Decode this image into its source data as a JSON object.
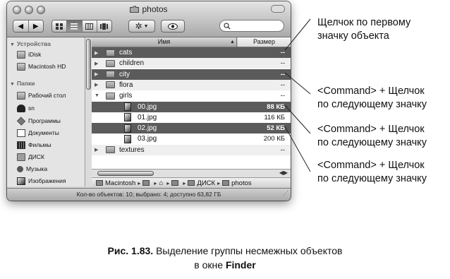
{
  "window": {
    "title": "photos",
    "search_value": ""
  },
  "sidebar": {
    "devices_heading": "Устройства",
    "devices": [
      {
        "label": "iDisk",
        "icon": "idisk-icon"
      },
      {
        "label": "Macintosh HD",
        "icon": "hard-disk-icon"
      }
    ],
    "places_heading": "Папки",
    "places": [
      {
        "label": "Рабочий стол",
        "icon": "desktop-icon"
      },
      {
        "label": "sn",
        "icon": "home-icon"
      },
      {
        "label": "Программы",
        "icon": "applications-icon"
      },
      {
        "label": "Документы",
        "icon": "documents-icon"
      },
      {
        "label": "Фильмы",
        "icon": "movies-icon"
      },
      {
        "label": "ДИСК",
        "icon": "folder-icon"
      },
      {
        "label": "Музыка",
        "icon": "music-icon"
      },
      {
        "label": "Изображения",
        "icon": "pictures-icon"
      }
    ]
  },
  "columns": {
    "name": "Имя",
    "size": "Размер"
  },
  "files": [
    {
      "name": "cats",
      "size": "--",
      "type": "folder",
      "selected": true,
      "expanded": false
    },
    {
      "name": "children",
      "size": "--",
      "type": "folder",
      "selected": false,
      "expanded": false
    },
    {
      "name": "city",
      "size": "--",
      "type": "folder",
      "selected": true,
      "expanded": false
    },
    {
      "name": "flora",
      "size": "--",
      "type": "folder",
      "selected": false,
      "expanded": false
    },
    {
      "name": "girls",
      "size": "--",
      "type": "folder",
      "selected": false,
      "expanded": true
    },
    {
      "name": "00.jpg",
      "size": "88 КБ",
      "type": "image",
      "selected": true,
      "child": true
    },
    {
      "name": "01.jpg",
      "size": "116 КБ",
      "type": "image",
      "selected": false,
      "child": true
    },
    {
      "name": "02.jpg",
      "size": "52 КБ",
      "type": "image",
      "selected": true,
      "child": true
    },
    {
      "name": "03.jpg",
      "size": "200 КБ",
      "type": "image",
      "selected": false,
      "child": true
    },
    {
      "name": "textures",
      "size": "--",
      "type": "folder",
      "selected": false,
      "expanded": false
    }
  ],
  "pathbar": [
    "Macintosh",
    "",
    "",
    "ДИСК",
    "photos"
  ],
  "status": "Кол-во объектов: 10; выбрано: 4; доступно 63,82 ГБ",
  "callouts": [
    {
      "line1": "Щелчок  по первому",
      "line2": "значку объекта"
    },
    {
      "line1": "<Command> + Щелчок",
      "line2": "по  следующему  значку"
    },
    {
      "line1": "<Command> + Щелчок",
      "line2": "по  следующему  значку"
    },
    {
      "line1": "<Command> + Щелчок",
      "line2": "по  следующему  значку"
    }
  ],
  "caption": {
    "figure": "Рис. 1.83.",
    "text": " Выделение группы несмежных объектов",
    "line2_pre": "в окне ",
    "line2_bold": "Finder"
  }
}
